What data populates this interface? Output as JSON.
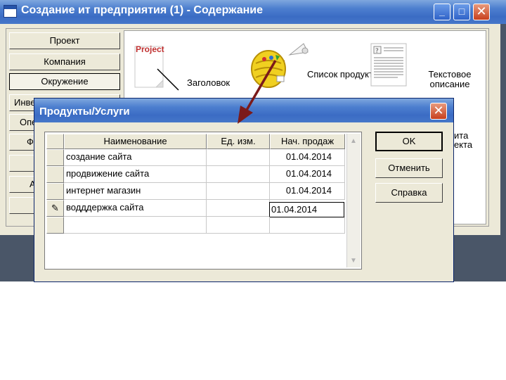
{
  "window": {
    "title": "Создание ит предприятия (1) - Содержание",
    "controls": {
      "minimize": "_",
      "maximize": "□",
      "close": "✕"
    }
  },
  "sidebar": {
    "items": [
      {
        "label": "Проект"
      },
      {
        "label": "Компания"
      },
      {
        "label": "Окружение"
      },
      {
        "label": "Инве"
      },
      {
        "label": "Опе"
      },
      {
        "label": "Ф"
      },
      {
        "label": ""
      },
      {
        "label": "А"
      },
      {
        "label": ""
      }
    ]
  },
  "canvas": {
    "header_icon_text": "Project",
    "header_label": "Заголовок",
    "products_label": "Список продуктов",
    "text_desc_label": "Текстовое описание",
    "partial_label_1": "ита",
    "partial_label_2": "екта"
  },
  "dialog": {
    "title": "Продукты/Услуги",
    "close": "✕",
    "grid": {
      "columns": [
        "Наименование",
        "Ед. изм.",
        "Нач. продаж"
      ],
      "rows": [
        {
          "name": "создание сайта",
          "unit": "",
          "start": "01.04.2014"
        },
        {
          "name": "продвижение сайта",
          "unit": "",
          "start": "01.04.2014"
        },
        {
          "name": "интернет магазин",
          "unit": "",
          "start": "01.04.2014"
        },
        {
          "name": "водддержка сайта",
          "unit": "",
          "start": "01.04.2014"
        }
      ],
      "edit_indicator": "✎"
    },
    "buttons": {
      "ok": "OK",
      "cancel": "Отменить",
      "help": "Справка"
    }
  },
  "colors": {
    "titlebar": "#3b6cc4",
    "face": "#ece9d8",
    "arrow": "#7b1a1a"
  }
}
